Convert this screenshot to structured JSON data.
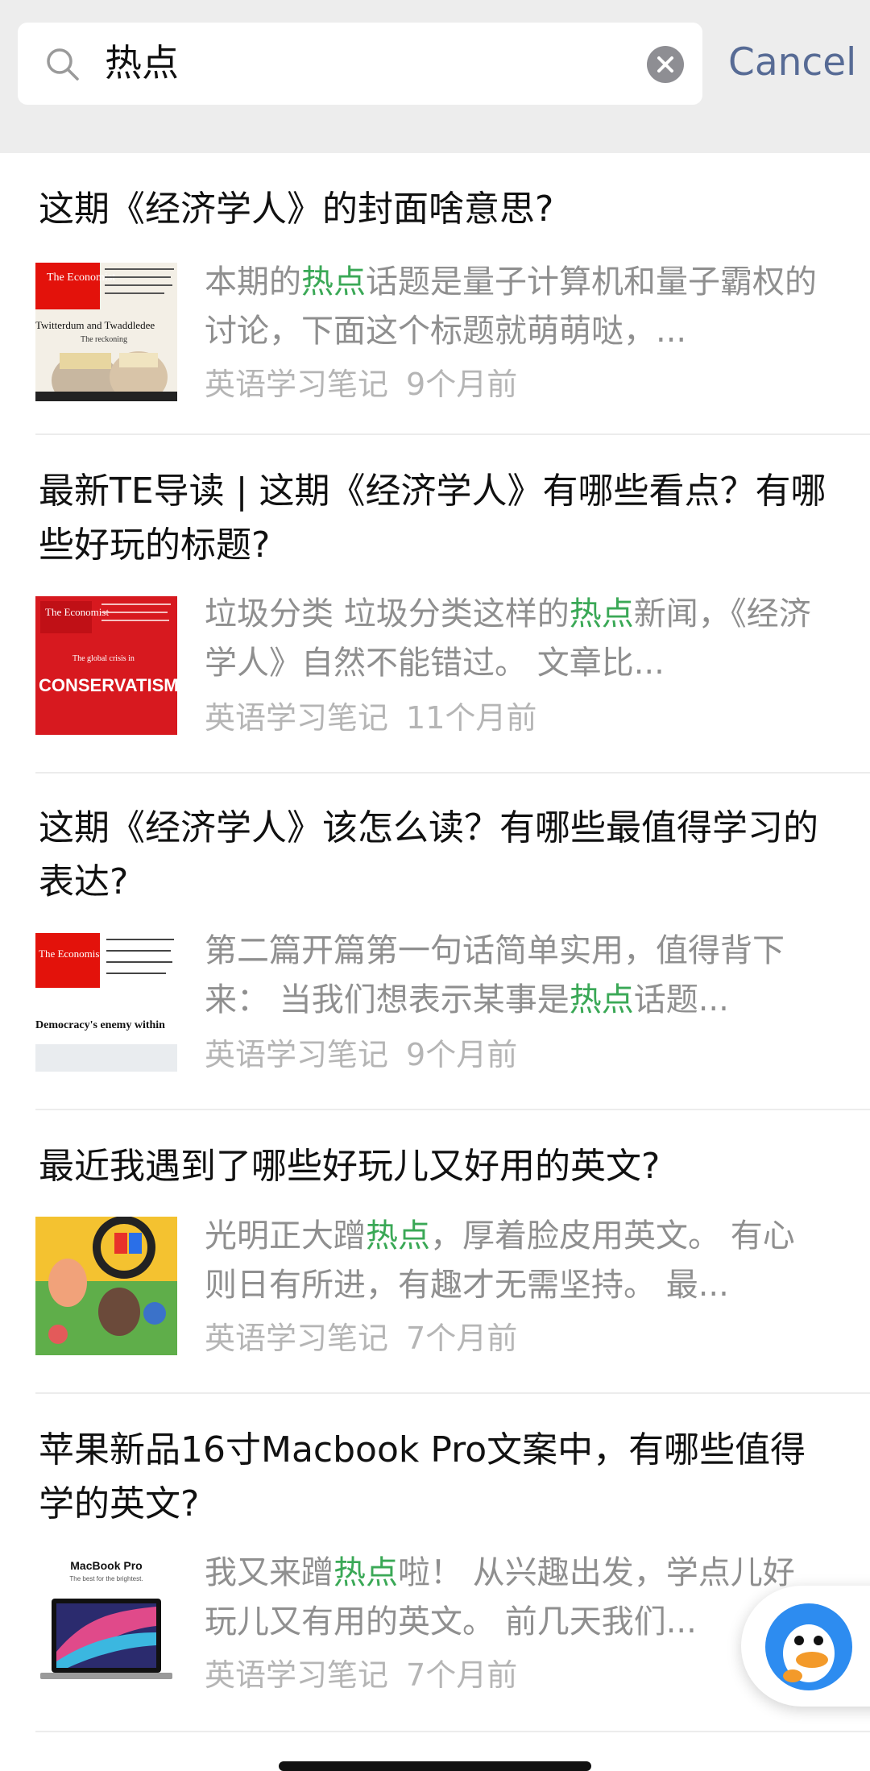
{
  "search": {
    "query": "热点",
    "cancel_label": "Cancel"
  },
  "colors": {
    "accent_link": "#576b95",
    "highlight": "#3aa856",
    "meta_gray": "#b5b5b5"
  },
  "results": [
    {
      "title": "这期《经济学人》的封面啥意思?",
      "snippet_parts": [
        {
          "text": "本期的",
          "hl": false
        },
        {
          "text": "热点",
          "hl": true
        },
        {
          "text": "话题是量子计算机和量子霸权的讨论，下面这个标题就萌萌哒，...",
          "hl": false
        }
      ],
      "source": "英语学习笔记",
      "time": "9个月前",
      "thumb": {
        "type": "economist",
        "masthead": "The Economist",
        "cover_line": "Twitterdum and Twaddledee",
        "sub_line": "The reckoning"
      }
    },
    {
      "title": "最新TE导读 | 这期《经济学人》有哪些看点？有哪些好玩的标题?",
      "snippet_parts": [
        {
          "text": "垃圾分类 垃圾分类这样的",
          "hl": false
        },
        {
          "text": "热点",
          "hl": true
        },
        {
          "text": "新闻，《经济学人》自然不能错过。 文章比...",
          "hl": false
        }
      ],
      "source": "英语学习笔记",
      "time": "11个月前",
      "thumb": {
        "type": "economist-red",
        "masthead": "The Economist",
        "cover_line": "CONSERVATISM",
        "sub_line": "The global crisis in"
      }
    },
    {
      "title": "这期《经济学人》该怎么读？有哪些最值得学习的表达?",
      "snippet_parts": [
        {
          "text": "第二篇开篇第一句话简单实用，值得背下来： 当我们想表示某事是",
          "hl": false
        },
        {
          "text": "热点",
          "hl": true
        },
        {
          "text": "话题...",
          "hl": false
        }
      ],
      "source": "英语学习笔记",
      "time": "9个月前",
      "thumb": {
        "type": "economist",
        "masthead": "The Economist",
        "cover_line": "Democracy's enemy within",
        "sub_line": ""
      }
    },
    {
      "title": "最近我遇到了哪些好玩儿又好用的英文?",
      "snippet_parts": [
        {
          "text": "光明正大蹭",
          "hl": false
        },
        {
          "text": "热点",
          "hl": true
        },
        {
          "text": "，厚着脸皮用英文。 有心则日有所进，有趣才无需坚持。 最...",
          "hl": false
        }
      ],
      "source": "英语学习笔记",
      "time": "7个月前",
      "thumb": {
        "type": "game"
      }
    },
    {
      "title": "苹果新品16寸Macbook Pro文案中，有哪些值得学的英文?",
      "snippet_parts": [
        {
          "text": "我又来蹭",
          "hl": false
        },
        {
          "text": "热点",
          "hl": true
        },
        {
          "text": "啦！ 从兴趣出发，学点儿好玩儿又有用的英文。 前几天我们...",
          "hl": false
        }
      ],
      "source": "英语学习笔记",
      "time": "7个月前",
      "thumb": {
        "type": "macbook",
        "heading": "MacBook Pro",
        "tagline": "The best for the brightest."
      }
    }
  ]
}
